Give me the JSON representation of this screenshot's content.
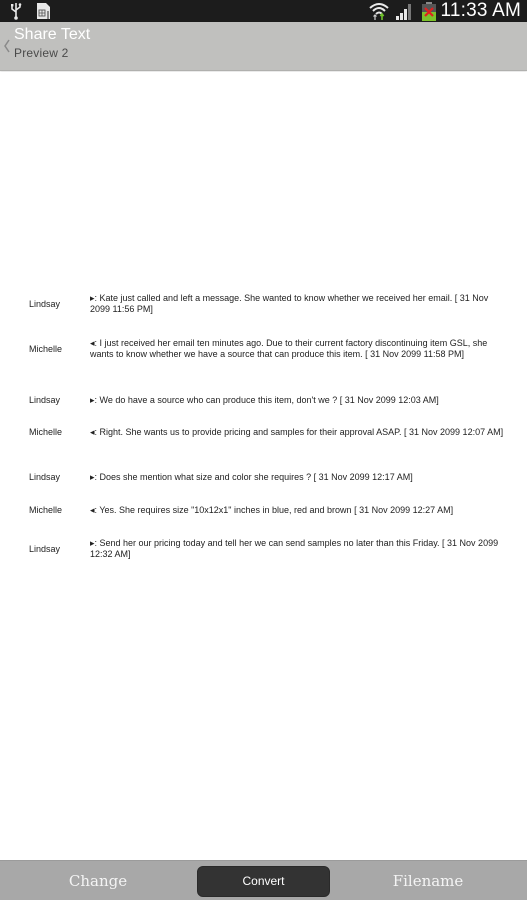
{
  "status_bar": {
    "time": "11:33 AM",
    "icons": [
      "usb-icon",
      "sim-card-icon",
      "wifi-icon",
      "signal-icon",
      "battery-icon"
    ]
  },
  "action_bar": {
    "title": "Share Text",
    "subtitle": "Preview  2",
    "back_icon": "chevron-left-icon"
  },
  "messages": [
    {
      "sender": "Lindsay",
      "text": "▸: Kate just called and left a message. She wanted to know whether we received her email. [ 31 Nov 2099 11:56 PM]"
    },
    {
      "sender": "Michelle",
      "text": "◂: I just received her email ten minutes ago. Due to their current factory discontinuing item GSL, she wants to know whether we have a source that can produce this item. [ 31 Nov 2099 11:58 PM]"
    },
    {
      "sender": "Lindsay",
      "text": "▸: We do have a source who can produce this item, don't we ? [ 31 Nov 2099 12:03 AM]"
    },
    {
      "sender": "Michelle",
      "text": "◂: Right. She wants us to provide pricing and samples for their approval ASAP. [ 31 Nov 2099 12:07 AM]"
    },
    {
      "sender": "Lindsay",
      "text": "▸: Does she mention what size and color she requires ? [ 31 Nov 2099 12:17 AM]"
    },
    {
      "sender": "Michelle",
      "text": "◂: Yes. She requires size \"10x12x1\" inches in blue, red and brown [ 31 Nov 2099 12:27 AM]"
    },
    {
      "sender": "Lindsay",
      "text": "▸: Send her our pricing today and tell her we can send samples no later than this Friday. [ 31 Nov 2099 12:32 AM]"
    }
  ],
  "bottom_bar": {
    "change_label": "Change",
    "convert_label": "Convert",
    "filename_label": "Filename"
  },
  "colors": {
    "status_bar_bg": "#1c1c1c",
    "action_bar_bg": "#c0c0be",
    "bottom_bar_bg": "#a8a8a8",
    "convert_button_bg": "#333333",
    "battery_green": "#7cc22a",
    "battery_alert_red": "#e02020"
  }
}
